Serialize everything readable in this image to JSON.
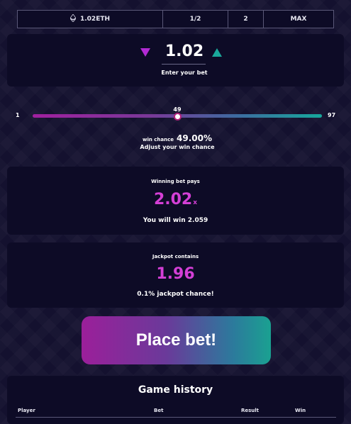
{
  "topbar": {
    "amount": "1.02ETH",
    "half": "1/2",
    "double": "2",
    "max": "MAX",
    "currency_icon": "ethereum-icon"
  },
  "bet": {
    "value": "1.02",
    "caption": "Enter your bet"
  },
  "slider": {
    "min": "1",
    "max": "97",
    "value": 49,
    "value_label": "49",
    "win_chance_label": "win chance",
    "win_chance_value": "49.00%",
    "adjust_caption": "Adjust your win chance"
  },
  "payout": {
    "heading": "Winning bet pays",
    "multiplier": "2.02",
    "suffix": "x",
    "win_text": "You will win 2.059"
  },
  "jackpot": {
    "heading": "Jackpot contains",
    "value": "1.96",
    "chance_text": "0.1% jackpot chance!"
  },
  "place_bet": {
    "label": "Place bet!"
  },
  "history": {
    "title": "Game history",
    "columns": [
      "Player",
      "Bet",
      "Result",
      "Win"
    ]
  },
  "colors": {
    "background": "#14112f",
    "panel": "#0d0b26",
    "pink": "#d43fd6",
    "teal": "#1aa89b",
    "purple": "#b22ad4"
  }
}
